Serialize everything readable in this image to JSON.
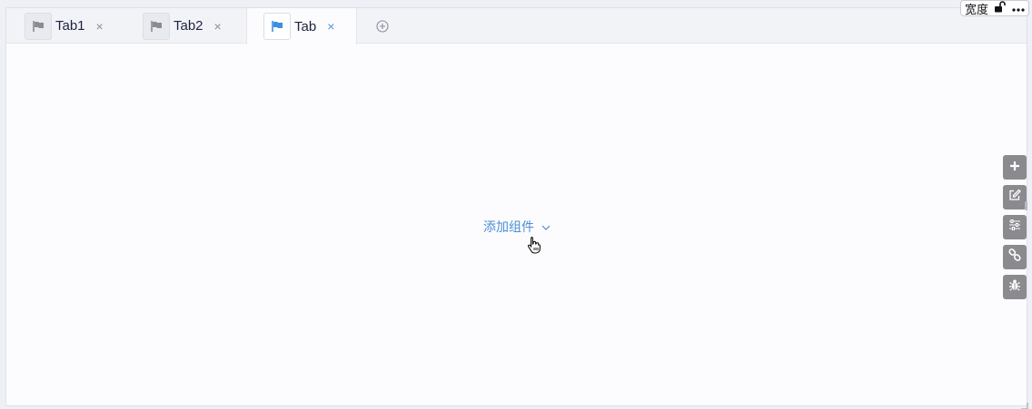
{
  "tabs": [
    {
      "label": "Tab1",
      "icon": "flag-icon",
      "active": false
    },
    {
      "label": "Tab2",
      "icon": "flag-icon",
      "active": false
    },
    {
      "label": "Tab",
      "icon": "flag-icon",
      "active": true
    }
  ],
  "tab_close_glyph": "×",
  "badge": {
    "label": "宽度",
    "lock_icon": "unlock-icon",
    "more_icon": "more-dots-icon"
  },
  "content": {
    "add_component_label": "添加组件"
  },
  "toolbar": [
    "plus-icon",
    "edit-icon",
    "sliders-icon",
    "link-icon",
    "bug-icon"
  ],
  "colors": {
    "accent": "#4a90d6",
    "tool_bg": "#8b8b8f",
    "tab_text": "#1d2340"
  }
}
